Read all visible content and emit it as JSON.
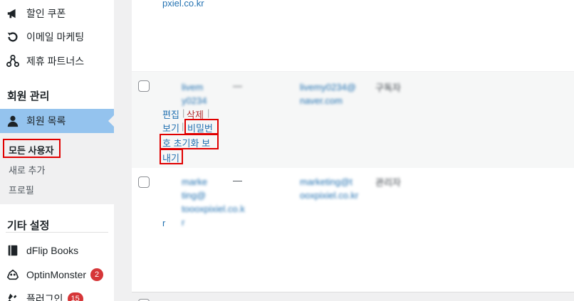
{
  "sidebar": {
    "items_top": [
      {
        "label": "할인 쿠폰",
        "icon": "megaphone-icon"
      },
      {
        "label": "이메일 마케팅",
        "icon": "refresh-icon"
      },
      {
        "label": "제휴 파트너스",
        "icon": "network-icon"
      }
    ],
    "section_members": "회원 관리",
    "members_list": {
      "label": "회원 목록",
      "icon": "user-icon"
    },
    "submenu": {
      "all_users": "모든 사용자",
      "add_new": "새로 추가",
      "profile": "프로필"
    },
    "section_other": "기타 설정",
    "items_bottom": [
      {
        "label": "dFlip Books",
        "icon": "book-icon"
      },
      {
        "label": "OptinMonster",
        "icon": "monster-icon",
        "badge": "2"
      },
      {
        "label": "플러그인",
        "icon": "plugin-icon",
        "badge": "15"
      }
    ]
  },
  "table": {
    "row1": {
      "email_tail": "pxiel.co.kr"
    },
    "row2": {
      "username": "livem y0234",
      "name": "—",
      "email": "livemy0234@ naver.com",
      "role": "구독자",
      "actions": {
        "edit": "편집",
        "delete": "삭제",
        "view": "보기",
        "reset_line1": "비밀번",
        "reset_line2": "호 초기화 보",
        "reset_line3": "내기"
      }
    },
    "row3": {
      "username": "marke ting@ toooxpixiel.co.k r",
      "name": "—",
      "email": "marketing@t ooxpixiel.co.kr",
      "role": "관리자",
      "username_tail": "r"
    }
  },
  "colors": {
    "accent": "#2271b1",
    "highlight_box": "#e00000",
    "active_menu": "#94c3ee",
    "badge": "#d63638"
  }
}
